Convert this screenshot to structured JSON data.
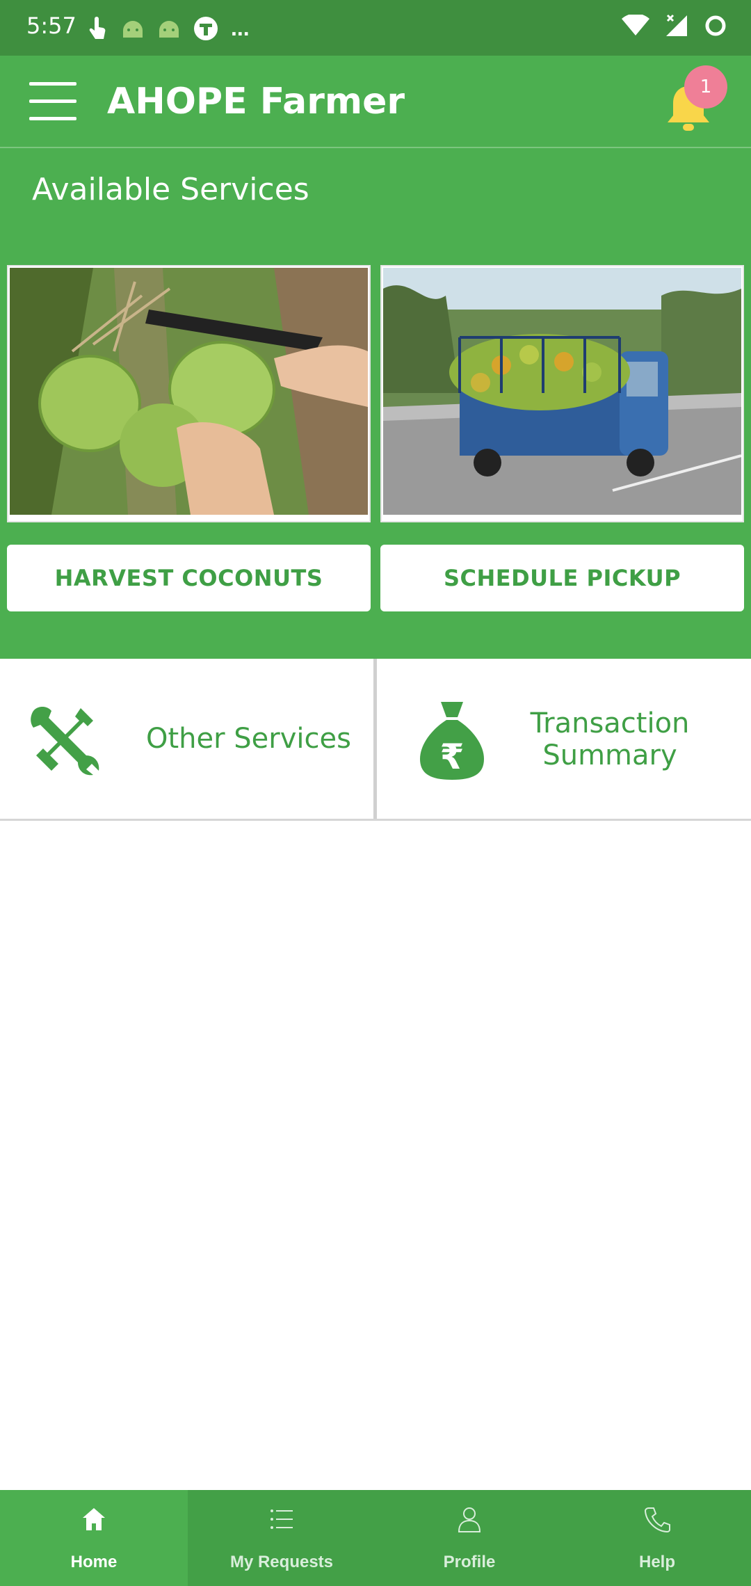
{
  "status_bar": {
    "time": "5:57",
    "notification_icons": [
      "touch-icon",
      "android-icon",
      "android-icon",
      "t-app-icon"
    ],
    "more": "...",
    "right_icons": [
      "wifi-icon",
      "signal-icon",
      "sync-icon"
    ]
  },
  "app_bar": {
    "title": "AHOPE Farmer",
    "notification_count": "1"
  },
  "services": {
    "title": "Available Services",
    "items": [
      {
        "label": "HARVEST COCONUTS",
        "image": "coconut-harvest-photo"
      },
      {
        "label": "SCHEDULE PICKUP",
        "image": "coconut-truck-photo"
      }
    ]
  },
  "tiles": {
    "other": "Other Services",
    "transaction_line1": "Transaction",
    "transaction_line2": "Summary"
  },
  "bottom_nav": {
    "items": [
      {
        "label": "Home",
        "icon": "home-icon",
        "active": true
      },
      {
        "label": "My Requests",
        "icon": "list-icon",
        "active": false
      },
      {
        "label": "Profile",
        "icon": "person-icon",
        "active": false
      },
      {
        "label": "Help",
        "icon": "phone-icon",
        "active": false
      }
    ]
  },
  "colors": {
    "primary": "#4caf50",
    "status_bar": "#3f8f3f",
    "accent_text": "#3f9f45",
    "badge": "#ef7f97",
    "bell": "#f9d64a"
  }
}
